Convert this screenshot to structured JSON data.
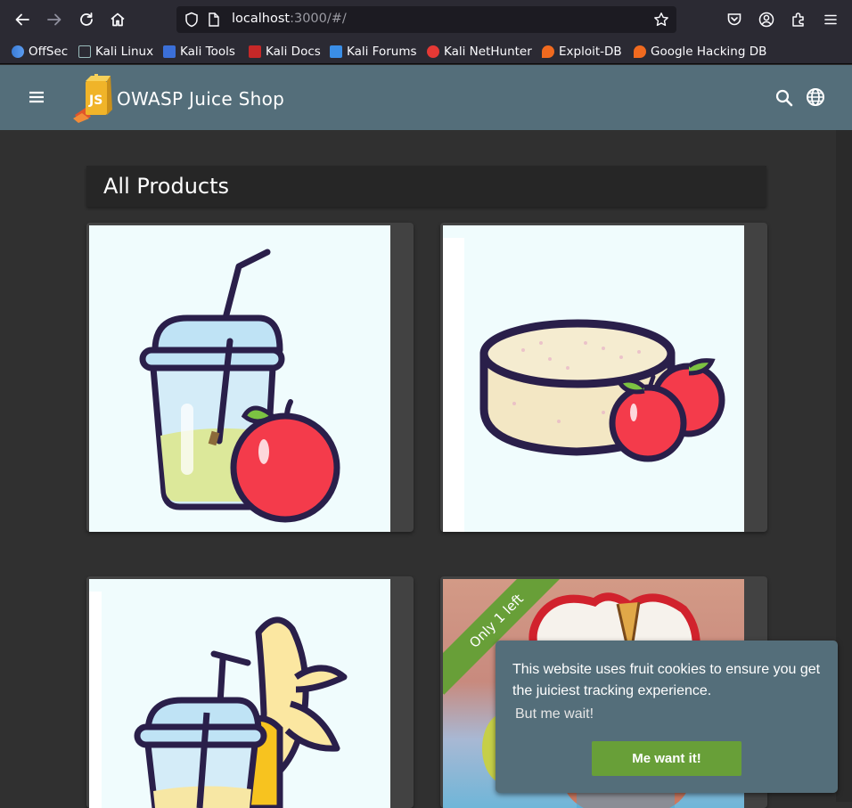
{
  "browser": {
    "url_host": "localhost",
    "url_rest": ":3000/#/",
    "bookmarks": [
      "OffSec",
      "Kali Linux",
      "Kali Tools",
      "Kali Docs",
      "Kali Forums",
      "Kali NetHunter",
      "Exploit-DB",
      "Google Hacking DB"
    ]
  },
  "app": {
    "title": "OWASP Juice Shop",
    "menu_icon": "menu-icon",
    "search_icon": "search-icon",
    "language_icon": "globe-icon"
  },
  "main": {
    "heading": "All Products",
    "products": [
      {
        "image": "apple-juice-icon"
      },
      {
        "image": "apple-pomace-icon"
      },
      {
        "image": "banana-juice-icon"
      },
      {
        "image": "product-photo",
        "ribbon": "Only 1 left"
      }
    ]
  },
  "cookie": {
    "message": "This website uses fruit cookies to ensure you get the juiciest tracking experience.",
    "link": "But me wait!",
    "button": "Me want it!"
  },
  "colors": {
    "toolbar": "#546e7a",
    "accent": "#689f38",
    "background": "#303030",
    "card": "#424242"
  }
}
